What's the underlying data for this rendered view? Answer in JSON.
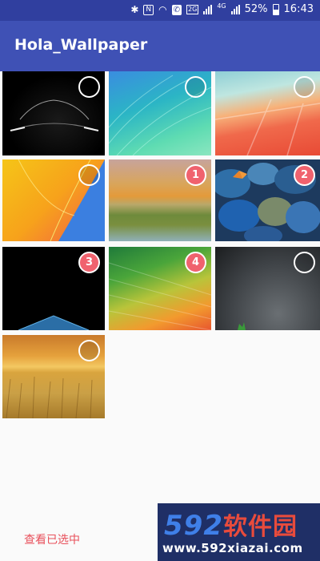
{
  "status_bar": {
    "icons": [
      "bluetooth-icon",
      "nfc-icon",
      "wifi-icon",
      "call-icon",
      "signal-2g-icon",
      "signal-4g-icon"
    ],
    "network_2g": "2G",
    "network_4g": "4G",
    "battery": "52%",
    "time": "16:43"
  },
  "app_bar": {
    "title": "Hola_Wallpaper"
  },
  "wallpapers": [
    {
      "name": "dark-car",
      "selected": false,
      "order": ""
    },
    {
      "name": "teal-feathers",
      "selected": false,
      "order": ""
    },
    {
      "name": "red-geometric",
      "selected": false,
      "order": ""
    },
    {
      "name": "yellow-blue-curve",
      "selected": false,
      "order": ""
    },
    {
      "name": "orange-green-texture",
      "selected": true,
      "order": "1"
    },
    {
      "name": "blue-pebbles-butterfly",
      "selected": true,
      "order": "2"
    },
    {
      "name": "black-blue-horizon",
      "selected": true,
      "order": "3"
    },
    {
      "name": "green-orange-gradient",
      "selected": true,
      "order": "4"
    },
    {
      "name": "grey-asphalt",
      "selected": false,
      "order": ""
    },
    {
      "name": "wheat-field-sunset",
      "selected": false,
      "order": ""
    }
  ],
  "bottom_bar": {
    "view_selected_label": "查看已选中"
  },
  "watermark": {
    "brand": "592",
    "brand_cn": "软件园",
    "url": "www.592xiazai.com"
  },
  "colors": {
    "primary": "#3f51b5",
    "status_bar": "#303f9f",
    "accent": "#e8505b",
    "badge": "#f0626e"
  }
}
